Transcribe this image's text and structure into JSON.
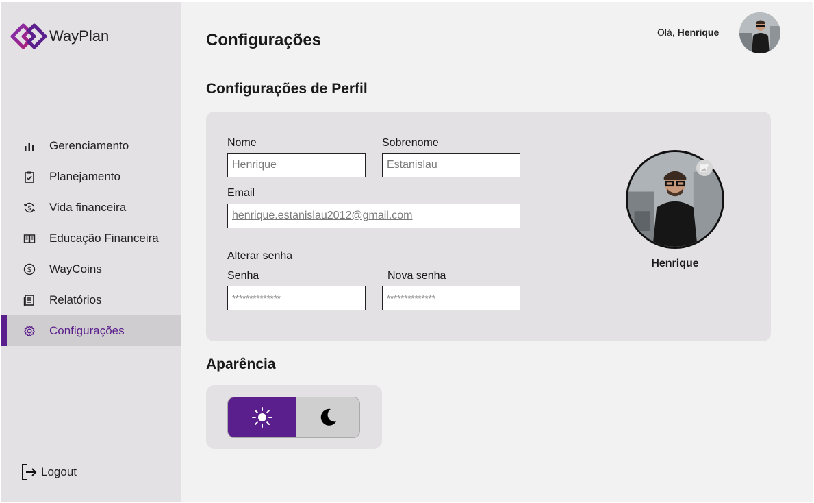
{
  "brand": {
    "name": "WayPlan",
    "color": "#5a1f8c"
  },
  "sidebar": {
    "items": [
      {
        "label": "Gerenciamento",
        "icon": "bar-chart-icon"
      },
      {
        "label": "Planejamento",
        "icon": "clipboard-check-icon"
      },
      {
        "label": "Vida financeira",
        "icon": "money-cycle-icon"
      },
      {
        "label": "Educação Financeira",
        "icon": "open-book-icon"
      },
      {
        "label": "WayCoins",
        "icon": "coin-dollar-icon"
      },
      {
        "label": "Relatórios",
        "icon": "report-icon"
      },
      {
        "label": "Configurações",
        "icon": "gear-icon",
        "active": true
      }
    ],
    "logout_label": "Logout"
  },
  "header": {
    "title": "Configurações",
    "greeting_prefix": "Olá,",
    "user_name": "Henrique"
  },
  "profile": {
    "section_title": "Configurações de Perfil",
    "first_name_label": "Nome",
    "first_name_value": "Henrique",
    "last_name_label": "Sobrenome",
    "last_name_value": "Estanislau",
    "email_label": "Email",
    "email_value": "henrique.estanislau2012@gmail.com",
    "change_password_label": "Alterar senha",
    "password_label": "Senha",
    "password_value": "**************",
    "new_password_label": "Nova senha",
    "new_password_value": "**************",
    "display_name": "Henrique"
  },
  "appearance": {
    "section_title": "Aparência",
    "selected": "light"
  }
}
